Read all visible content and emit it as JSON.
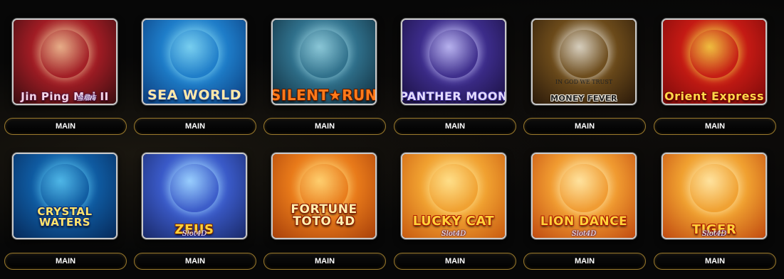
{
  "games": [
    {
      "id": "g1",
      "title": "Jin Ping Mai II",
      "subtitle": "金瓶梅",
      "button": "MAIN",
      "colors": [
        "#3a0d10",
        "#a01c24",
        "#e8b08a"
      ],
      "title_color": "#f2d6e8",
      "stroke": "#5a1030"
    },
    {
      "id": "g2",
      "title": "SEA WORLD",
      "subtitle": "",
      "button": "MAIN",
      "colors": [
        "#0a3b7a",
        "#1e7cc8",
        "#7ad0f0"
      ],
      "title_color": "#ffe9a8",
      "stroke": "#1b4aa0"
    },
    {
      "id": "g3",
      "title": "SILENT★RUN",
      "subtitle": "",
      "button": "MAIN",
      "colors": [
        "#0f2b3a",
        "#2f6f8a",
        "#8cc8d8"
      ],
      "title_color": "#ff7a1a",
      "stroke": "#5a1a00"
    },
    {
      "id": "g4",
      "title": "PANTHER MOON",
      "subtitle": "",
      "button": "MAIN",
      "colors": [
        "#1a1040",
        "#3c2c8a",
        "#b9b4f0"
      ],
      "title_color": "#e4dcff",
      "stroke": "#3a2a90"
    },
    {
      "id": "g5",
      "title": "MONEY FEVER",
      "subtitle": "IN GOD WE TRUST",
      "button": "MAIN",
      "colors": [
        "#2b1a0a",
        "#6b4a1a",
        "#d8d0c0"
      ],
      "title_color": "#1e1e1e",
      "stroke": "#e8e4da"
    },
    {
      "id": "g6",
      "title": "Orient Express",
      "subtitle": "",
      "button": "MAIN",
      "colors": [
        "#7a0a0a",
        "#c41a14",
        "#f0c040"
      ],
      "title_color": "#ffd84a",
      "stroke": "#7a0000"
    },
    {
      "id": "g7",
      "title": "CRYSTAL WATERS",
      "subtitle": "",
      "button": "MAIN",
      "colors": [
        "#062a5a",
        "#0f5aa0",
        "#50b8e8"
      ],
      "title_color": "#ffe46a",
      "stroke": "#0a2a70"
    },
    {
      "id": "g8",
      "title": "ZEUS",
      "subtitle": "Slot4D",
      "button": "MAIN",
      "colors": [
        "#1a2a6a",
        "#3a5ac8",
        "#9ad0ff"
      ],
      "title_color": "#ffd23a",
      "stroke": "#7a2a00"
    },
    {
      "id": "g9",
      "title": "FORTUNE TOTO 4D",
      "subtitle": "",
      "button": "MAIN",
      "colors": [
        "#a8400a",
        "#e87a1a",
        "#ffd070"
      ],
      "title_color": "#fff0b0",
      "stroke": "#8a1a00"
    },
    {
      "id": "g10",
      "title": "LUCKY CAT",
      "subtitle": "Slot4D",
      "button": "MAIN",
      "colors": [
        "#c85a10",
        "#f0a030",
        "#ffe08a"
      ],
      "title_color": "#ffd23a",
      "stroke": "#b01a00"
    },
    {
      "id": "g11",
      "title": "LION DANCE",
      "subtitle": "Slot4D",
      "button": "MAIN",
      "colors": [
        "#c04a10",
        "#f09a30",
        "#ffe4a0"
      ],
      "title_color": "#ffd23a",
      "stroke": "#b01a00"
    },
    {
      "id": "g12",
      "title": "TIGER",
      "subtitle": "Slot4D",
      "button": "MAIN",
      "colors": [
        "#c04a10",
        "#f0a030",
        "#ffe4a0"
      ],
      "title_color": "#ffd23a",
      "stroke": "#b01a00"
    }
  ]
}
